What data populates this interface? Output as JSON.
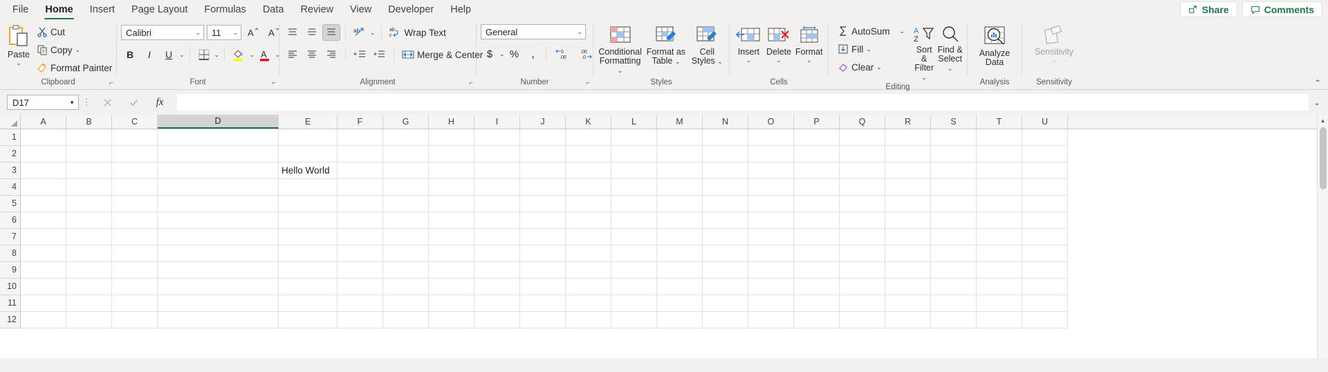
{
  "tabs": [
    {
      "label": "File",
      "active": false
    },
    {
      "label": "Home",
      "active": true
    },
    {
      "label": "Insert",
      "active": false
    },
    {
      "label": "Page Layout",
      "active": false
    },
    {
      "label": "Formulas",
      "active": false
    },
    {
      "label": "Data",
      "active": false
    },
    {
      "label": "Review",
      "active": false
    },
    {
      "label": "View",
      "active": false
    },
    {
      "label": "Developer",
      "active": false
    },
    {
      "label": "Help",
      "active": false
    }
  ],
  "titlebar": {
    "share_label": "Share",
    "comments_label": "Comments",
    "accent_green": "#217346"
  },
  "ribbon": {
    "clipboard": {
      "group_label": "Clipboard",
      "paste_label": "Paste",
      "cut_label": "Cut",
      "copy_label": "Copy",
      "format_painter_label": "Format Painter"
    },
    "font": {
      "group_label": "Font",
      "font_name": "Calibri",
      "font_size": "11",
      "bold_label": "B",
      "italic_label": "I",
      "underline_label": "U",
      "grow_font_label": "A",
      "shrink_font_label": "A"
    },
    "alignment": {
      "group_label": "Alignment",
      "wrap_text_label": "Wrap Text",
      "merge_center_label": "Merge & Center"
    },
    "number": {
      "group_label": "Number",
      "format_value": "General",
      "currency_label": "$",
      "percent_label": "%",
      "comma_label": ","
    },
    "styles": {
      "group_label": "Styles",
      "conditional_formatting_label": "Conditional\nFormatting",
      "cf_line1": "Conditional",
      "cf_line2": "Formatting",
      "fat_line1": "Format as",
      "fat_line2": "Table",
      "cs_line1": "Cell",
      "cs_line2": "Styles"
    },
    "cells": {
      "group_label": "Cells",
      "insert_label": "Insert",
      "delete_label": "Delete",
      "format_label": "Format"
    },
    "editing": {
      "group_label": "Editing",
      "autosum_label": "AutoSum",
      "fill_label": "Fill",
      "clear_label": "Clear",
      "sort_filter_line1": "Sort &",
      "sort_filter_line2": "Filter",
      "find_select_line1": "Find &",
      "find_select_line2": "Select"
    },
    "analysis": {
      "group_label": "Analysis",
      "analyze_line1": "Analyze",
      "analyze_line2": "Data"
    },
    "sensitivity": {
      "group_label": "Sensitivity",
      "sensitivity_label": "Sensitivity"
    }
  },
  "formula_bar": {
    "name_box_value": "D17",
    "cancel_icon": "✕",
    "enter_icon": "✓",
    "fx_icon": "fx",
    "formula_value": "",
    "expand_caret": "⌄"
  },
  "grid": {
    "columns": [
      "A",
      "B",
      "C",
      "D",
      "E",
      "F",
      "G",
      "H",
      "I",
      "J",
      "K",
      "L",
      "M",
      "N",
      "O",
      "P",
      "Q",
      "R",
      "S",
      "T",
      "U"
    ],
    "selected_column": "D",
    "rows": [
      "1",
      "2",
      "3",
      "4",
      "5",
      "6",
      "7",
      "8",
      "9",
      "10",
      "11",
      "12"
    ],
    "cell_contents": [
      {
        "row": "3",
        "col": "E",
        "value": "Hello World"
      }
    ]
  }
}
